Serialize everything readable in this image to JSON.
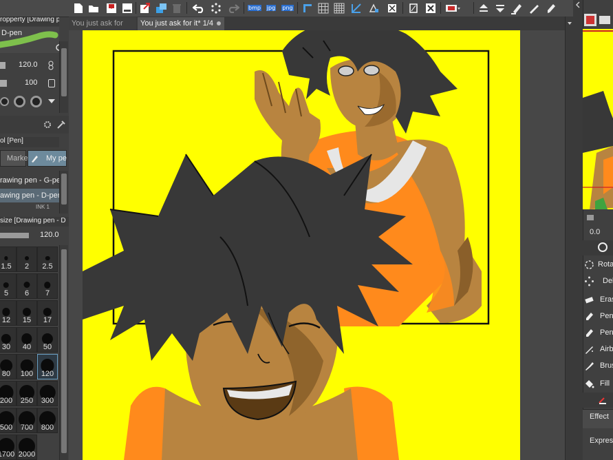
{
  "toolbar": {
    "export_bmp": "bmp",
    "export_jpg": "jpg",
    "export_png": "png"
  },
  "left_panel": {
    "sub_tool_header": "ropperty [Drawing pen",
    "brush_name": "D-pen",
    "brush_size_value": "120.0",
    "opacity_value": "100",
    "sub_tool_group_header": "ol [Pen]",
    "group_tabs": [
      "Marke",
      "My pe"
    ],
    "brush_list": [
      "rawing pen - G-pen",
      "awing pen - D-pen",
      "INK 1"
    ],
    "size_header": "size [Drawing pen - D",
    "size_slider_value": "120.0",
    "brush_sizes": [
      "1.5",
      "2",
      "2.5",
      "5",
      "6",
      "7",
      "12",
      "15",
      "17",
      "30",
      "40",
      "50",
      "80",
      "100",
      "120",
      "200",
      "250",
      "300",
      "500",
      "700",
      "800",
      "1700",
      "2000"
    ]
  },
  "tabs": [
    {
      "label": "You just ask for"
    },
    {
      "label": "You just ask for it* 1/4",
      "active": true
    }
  ],
  "right_panel": {
    "slider_value": "0.0",
    "tools": [
      "Rota",
      "Del",
      "Eras",
      "Pen",
      "Pen",
      "Airb",
      "Brus",
      "Fill"
    ],
    "effect_label": "Effect",
    "express_label": "Express"
  },
  "colors": {
    "canvas_bg": "#ffff00",
    "skin": "#b88440",
    "skin_shadow": "#6e4a1c",
    "hair": "#383838",
    "shirt": "#ff8a1c",
    "ui_panel": "#404040",
    "active_tab": "#555555"
  },
  "icons": [
    "new-file-icon",
    "open-folder-icon",
    "save-icon",
    "print-icon",
    "export-icon",
    "layers-icon",
    "trash-icon",
    "undo-icon",
    "loading-icon",
    "redo-icon",
    "ruler-icon",
    "grid-icon",
    "grid-icon",
    "transform-icon",
    "select-icon",
    "snap-icon",
    "mask-icon",
    "close-icon",
    "record-icon",
    "nav-up-icon",
    "nav-down-icon",
    "eraser-icon",
    "pen-icon"
  ]
}
